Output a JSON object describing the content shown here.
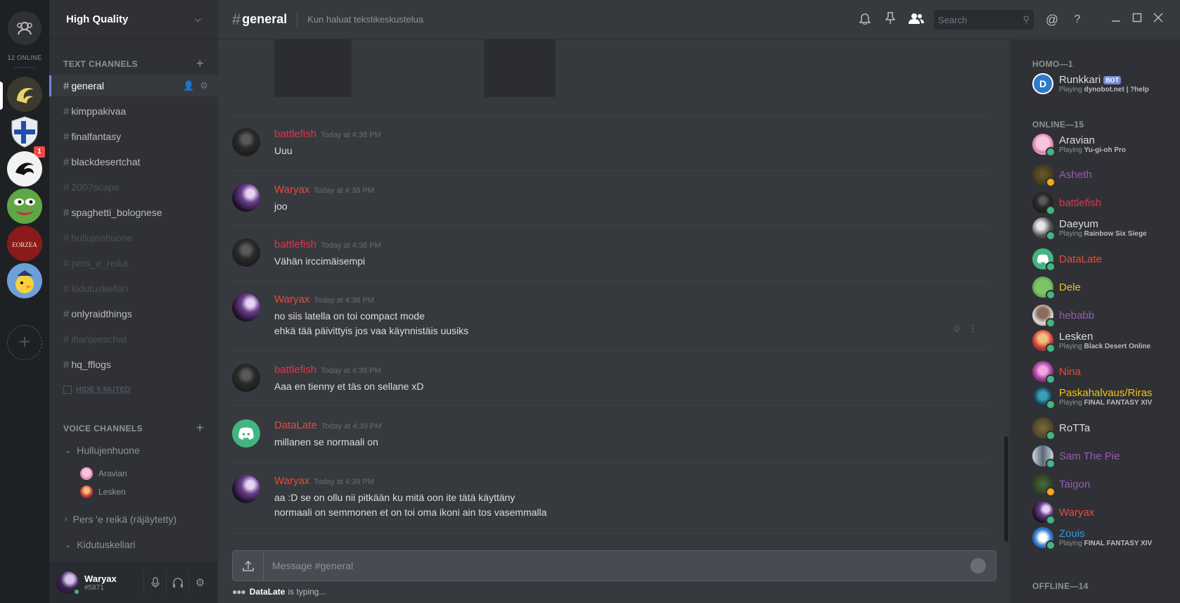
{
  "rail": {
    "online_count": "12 ONLINE",
    "badge_count": "1"
  },
  "guild": {
    "name": "High Quality"
  },
  "sidebar": {
    "text_channels_label": "TEXT CHANNELS",
    "voice_channels_label": "VOICE CHANNELS",
    "hide_muted": "HIDE 5 MUTED",
    "channels": [
      {
        "name": "general"
      },
      {
        "name": "kimppakivaa"
      },
      {
        "name": "finalfantasy"
      },
      {
        "name": "blackdesertchat"
      },
      {
        "name": "2007scape"
      },
      {
        "name": "spaghetti_bolognese"
      },
      {
        "name": "hullujenhuone"
      },
      {
        "name": "pers_e_reika"
      },
      {
        "name": "kidutuskellari"
      },
      {
        "name": "onlyraidthings"
      },
      {
        "name": "ihanjeeschat"
      },
      {
        "name": "hq_fflogs"
      }
    ],
    "voice": [
      {
        "name": "Hullujenhuone"
      },
      {
        "name": "Pers 'e reikä (räjäytetty)"
      },
      {
        "name": "Kidutuskellari"
      }
    ],
    "voice_users": [
      "Aravian",
      "Lesken"
    ]
  },
  "user": {
    "name": "Waryax",
    "discriminator": "#5871"
  },
  "header": {
    "channel": "general",
    "topic": "Kun haluat tekstikeskustelua",
    "search_placeholder": "Search"
  },
  "messages": [
    {
      "author": "battlefish",
      "time": "Today at 4:38 PM",
      "lines": [
        "Uuu"
      ],
      "color": "#e0344d"
    },
    {
      "author": "Waryax",
      "time": "Today at 4:38 PM",
      "lines": [
        "joo"
      ],
      "color": "#e74c3c"
    },
    {
      "author": "battlefish",
      "time": "Today at 4:38 PM",
      "lines": [
        "Vähän irccimäisempi"
      ],
      "color": "#e0344d"
    },
    {
      "author": "Waryax",
      "time": "Today at 4:38 PM",
      "lines": [
        "no siis latella on toi compact mode",
        "ehkä tää päivittyis jos vaa käynnistäis uusiks"
      ],
      "color": "#e74c3c"
    },
    {
      "author": "battlefish",
      "time": "Today at 4:39 PM",
      "lines": [
        "Aaa en tienny et täs on sellane xD"
      ],
      "color": "#e0344d"
    },
    {
      "author": "DataLate",
      "time": "Today at 4:39 PM",
      "lines": [
        "millanen se normaali on"
      ],
      "color": "#e74c3c"
    },
    {
      "author": "Waryax",
      "time": "Today at 4:39 PM",
      "lines": [
        "aa :D se on ollu nii pitkään ku mitä oon ite tätä käyttäny",
        "normaali on semmonen et on toi oma ikoni ain tos vasemmalla"
      ],
      "color": "#e74c3c"
    }
  ],
  "composer": {
    "placeholder": "Message #general"
  },
  "typing": {
    "user": "DataLate",
    "suffix": "is typing..."
  },
  "members": {
    "groups": [
      {
        "label": "HOMO—1"
      },
      {
        "label": "ONLINE—15"
      },
      {
        "label": "OFFLINE—14"
      }
    ],
    "list": [
      {
        "name": "Runkkari",
        "tag": "BOT",
        "playing": "Playing",
        "game": "dynobot.net | ?help",
        "color": "#dcddde",
        "status": "none"
      },
      {
        "name": "Aravian",
        "playing": "Playing",
        "game": "Yu-gi-oh Pro",
        "color": "#dcddde",
        "status": "#43b581"
      },
      {
        "name": "Asheth",
        "color": "#9b59b6",
        "status": "#faa61a"
      },
      {
        "name": "battlefish",
        "color": "#e0344d",
        "status": "#43b581"
      },
      {
        "name": "Daeyum",
        "playing": "Playing",
        "game": "Rainbow Six Siege",
        "color": "#dcddde",
        "status": "#43b581"
      },
      {
        "name": "DataLate",
        "color": "#e74c3c",
        "status": "#43b581"
      },
      {
        "name": "Dele",
        "color": "#f1c40f",
        "status": "#43b581"
      },
      {
        "name": "hebabb",
        "color": "#9b59b6",
        "status": "#43b581"
      },
      {
        "name": "Lesken",
        "playing": "Playing",
        "game": "Black Desert Online",
        "color": "#dcddde",
        "status": "#43b581"
      },
      {
        "name": "Nina",
        "color": "#e74c3c",
        "status": "#43b581"
      },
      {
        "name": "Paskahalvaus/Riras",
        "playing": "Playing",
        "game": "FINAL FANTASY XIV",
        "color": "#f1c40f",
        "status": "#43b581"
      },
      {
        "name": "RoTTa",
        "color": "#dcddde",
        "status": "#43b581"
      },
      {
        "name": "Sam The Pie",
        "color": "#9b59b6",
        "status": "#43b581"
      },
      {
        "name": "Taigon",
        "color": "#9b59b6",
        "status": "#faa61a"
      },
      {
        "name": "Waryax",
        "color": "#e74c3c",
        "status": "#43b581"
      },
      {
        "name": "Zouis",
        "playing": "Playing",
        "game": "FINAL FANTASY XIV",
        "color": "#3498db",
        "status": "#43b581"
      }
    ]
  }
}
